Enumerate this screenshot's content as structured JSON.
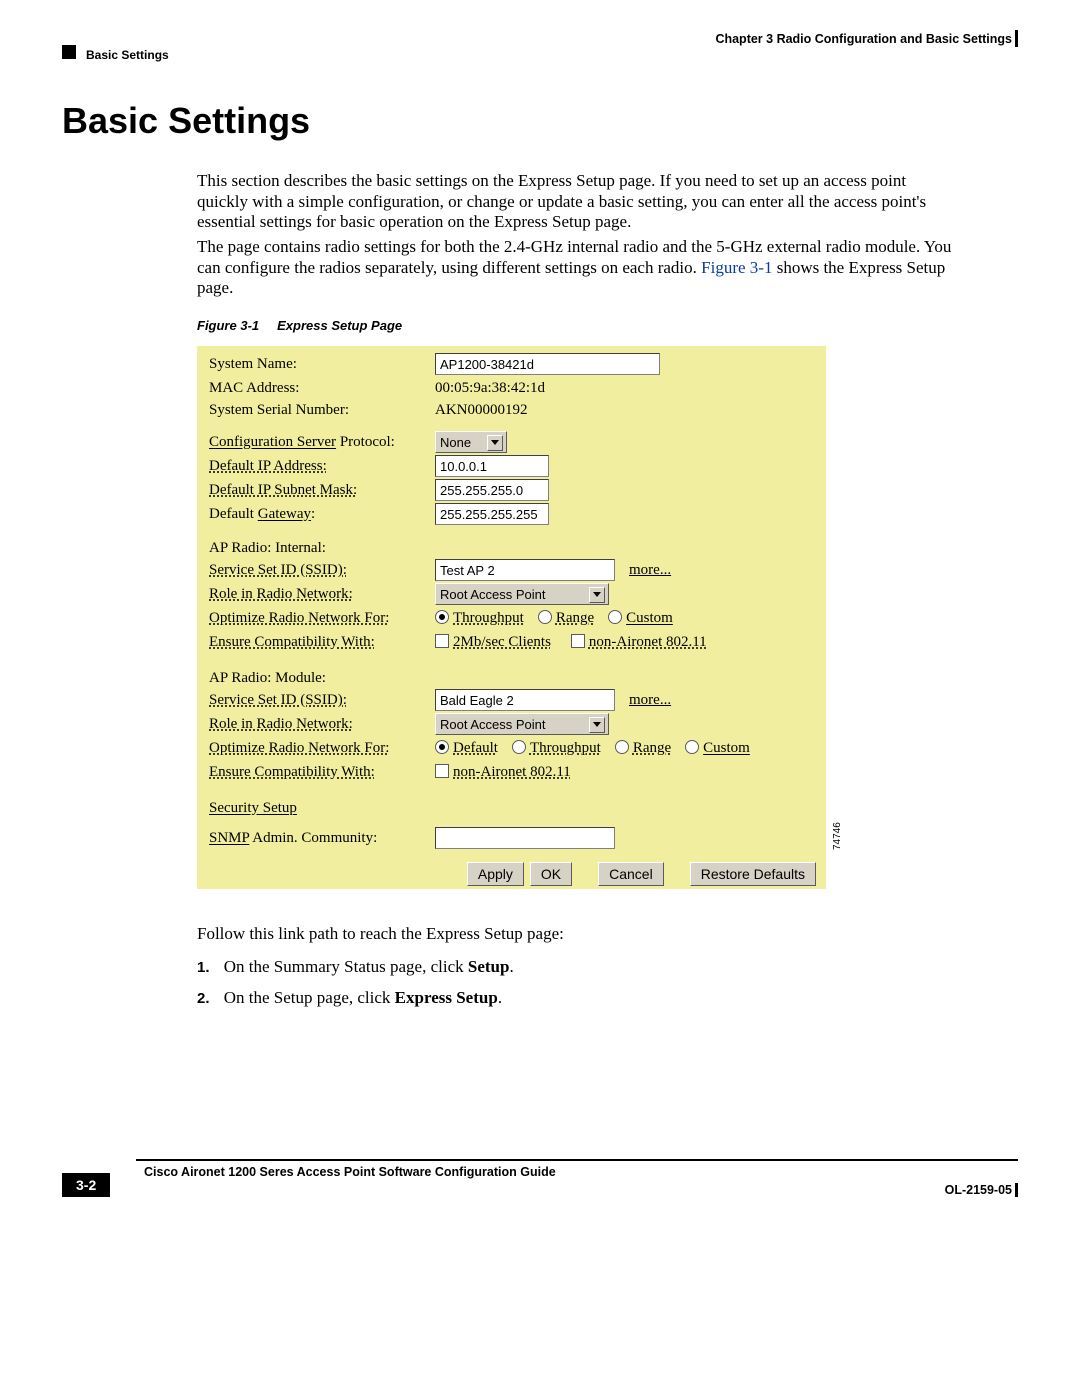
{
  "header": {
    "chapter": "Chapter 3    Radio Configuration and Basic Settings",
    "section": "Basic Settings"
  },
  "title": "Basic Settings",
  "paragraphs": {
    "p1": "This section describes the basic settings on the Express Setup page. If you need to set up an access point quickly with a simple configuration, or change or update a basic setting, you can enter all the access point's essential settings for basic operation on the Express Setup page.",
    "p2a": "The page contains radio settings for both the 2.4-GHz internal radio and the 5-GHz external radio module. You can configure the radios separately, using different settings on each radio. ",
    "p2_figref": "Figure 3-1",
    "p2b": " shows the Express Setup page."
  },
  "figcap": {
    "num": "Figure 3-1",
    "title": "Express Setup Page"
  },
  "express": {
    "labels": {
      "sysname": "System Name:",
      "mac": "MAC Address:",
      "serial": "System Serial Number:",
      "cfgproto_a": "Configuration Server",
      "cfgproto_b": " Protocol:",
      "defip": "Default IP Address:",
      "defmask": "Default IP Subnet Mask:",
      "defgw_a": "Default ",
      "defgw_b": "Gateway",
      "defgw_c": ":",
      "ap_int": "AP Radio: Internal:",
      "ssid": "Service Set ID (SSID):",
      "role": "Role in Radio Network:",
      "optimize": "Optimize Radio Network For:",
      "compat": "Ensure Compatibility With:",
      "ap_mod": "AP Radio: Module:",
      "security": "Security Setup",
      "snmp_a": "SNMP",
      "snmp_b": " Admin. Community:"
    },
    "values": {
      "sysname": "AP1200-38421d",
      "mac": "00:05:9a:38:42:1d",
      "serial": "AKN00000192",
      "cfgproto": "None",
      "defip": "10.0.0.1",
      "defmask": "255.255.255.0",
      "defgw": "255.255.255.255",
      "ssid_int": "Test AP 2",
      "role_int": "Root Access Point",
      "more": "more...",
      "opt_throughput": "Throughput",
      "opt_range": "Range",
      "opt_custom": "Custom",
      "opt_default": "Default",
      "compat_2mb": "2Mb/sec Clients",
      "compat_nonair": "non-Aironet 802.11",
      "ssid_mod": "Bald Eagle 2",
      "role_mod": "Root Access Point"
    },
    "buttons": {
      "apply": "Apply",
      "ok": "OK",
      "cancel": "Cancel",
      "restore": "Restore Defaults"
    },
    "image_id": "74746"
  },
  "follow": "Follow this link path to reach the Express Setup page:",
  "steps": {
    "s1_num": "1.",
    "s1a": "On the Summary Status page, click ",
    "s1b": "Setup",
    "s1c": ".",
    "s2_num": "2.",
    "s2a": "On the Setup page, click ",
    "s2b": "Express Setup",
    "s2c": "."
  },
  "footer": {
    "guide": "Cisco Aironet 1200 Seres Access Point Software Configuration Guide",
    "page": "3-2",
    "docnum": "OL-2159-05"
  }
}
